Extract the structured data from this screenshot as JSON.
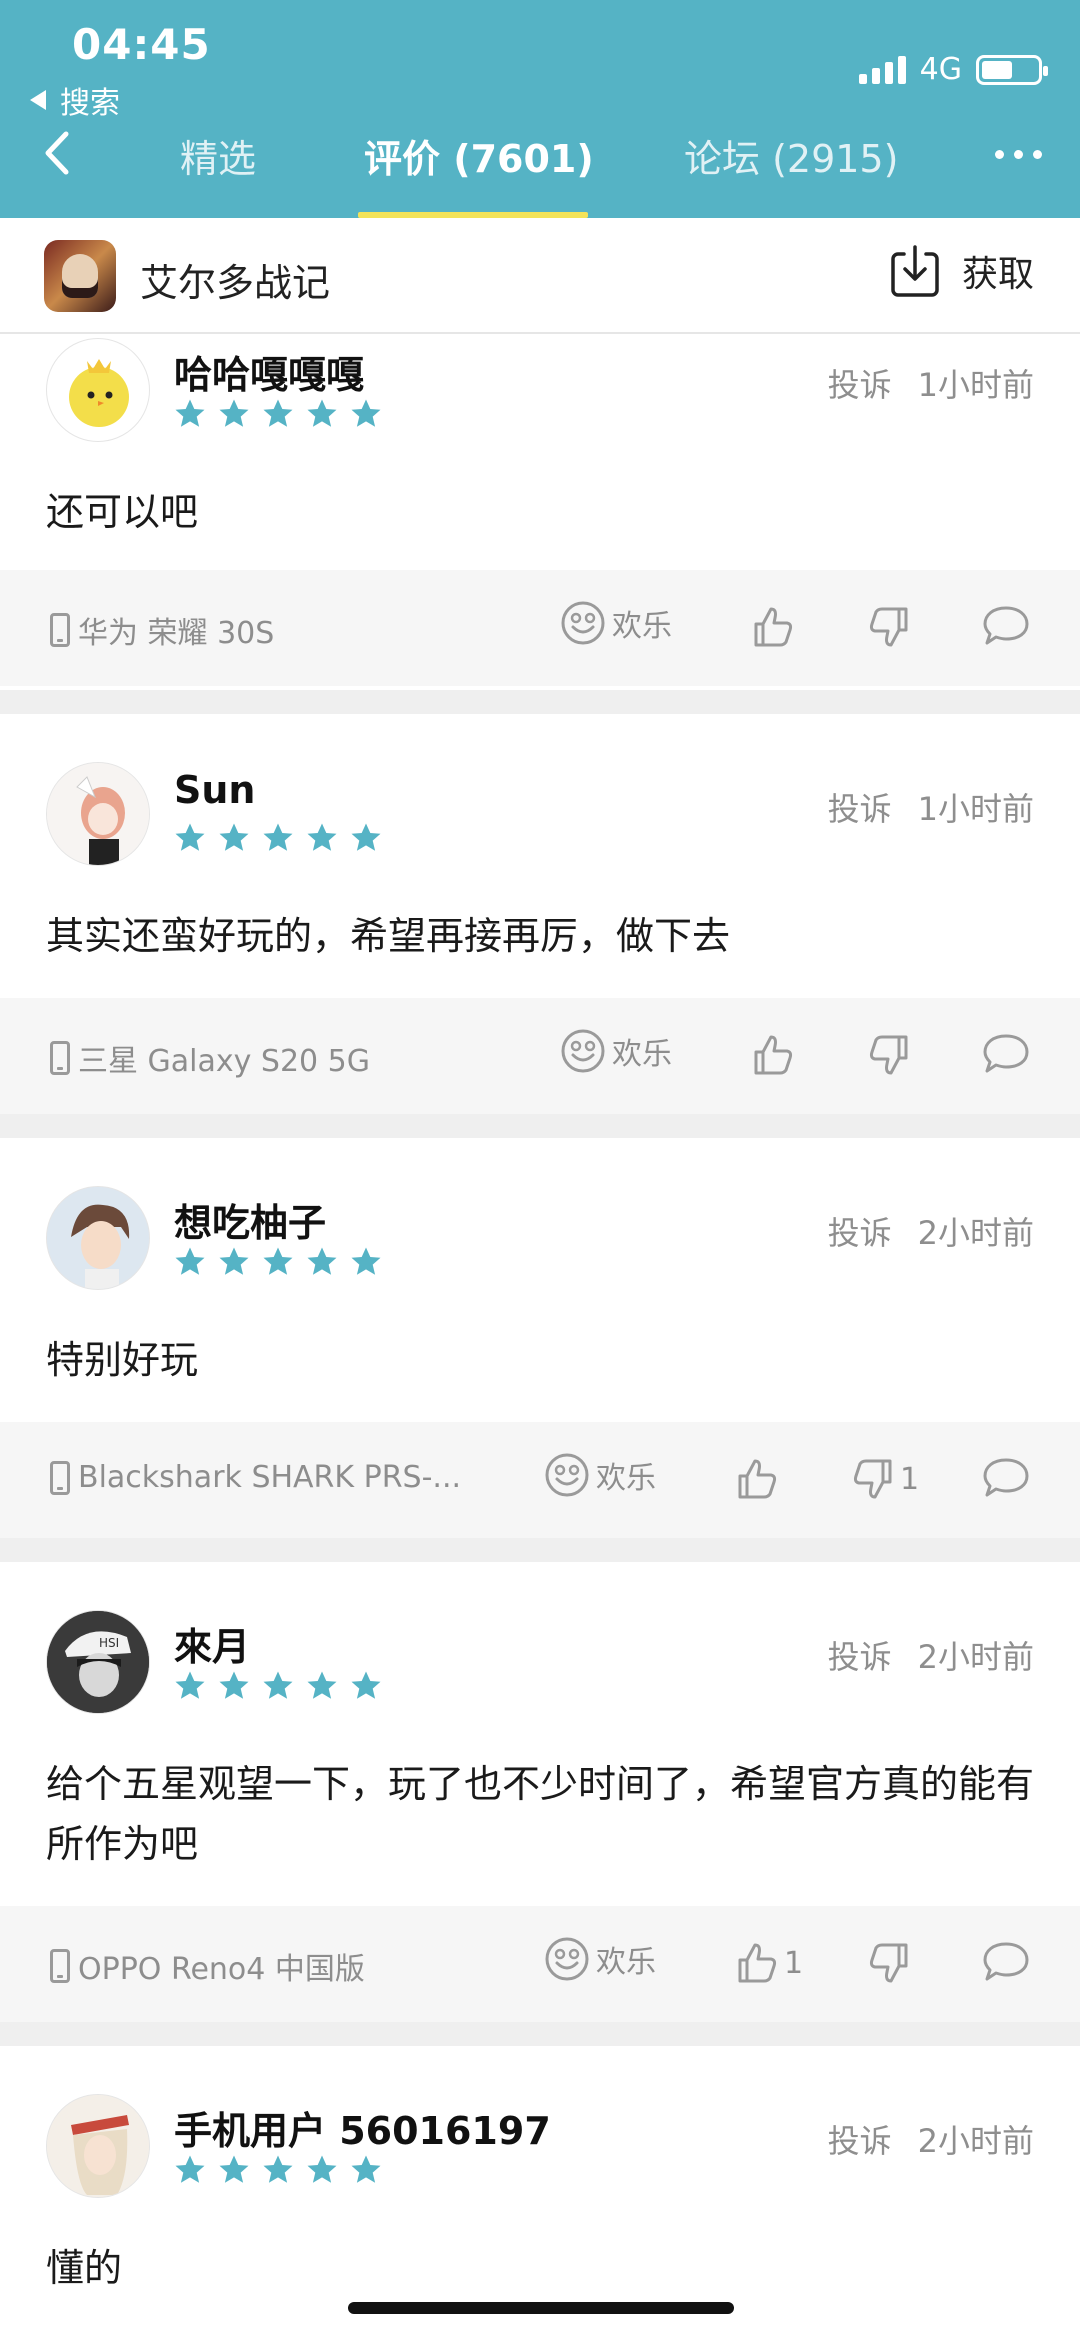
{
  "status": {
    "time": "04:45",
    "back_label": "搜索",
    "network": "4G"
  },
  "tabs": [
    {
      "label": "精选"
    },
    {
      "label": "评价 (7601)"
    },
    {
      "label": "论坛 (2915)"
    }
  ],
  "app": {
    "name": "艾尔多战记",
    "get_label": "获取"
  },
  "accent_color": "#55b3c5",
  "reviews": [
    {
      "user": "哈哈嘎嘎嘎",
      "rating": 5,
      "report": "投诉",
      "time": "1小时前",
      "text": "还可以吧",
      "device": "华为 荣耀 30S",
      "mood": "欢乐",
      "likes": "",
      "dislikes": ""
    },
    {
      "user": "Sun",
      "rating": 5,
      "report": "投诉",
      "time": "1小时前",
      "text": "其实还蛮好玩的，希望再接再厉，做下去",
      "device": "三星 Galaxy S20 5G",
      "mood": "欢乐",
      "likes": "",
      "dislikes": ""
    },
    {
      "user": "想吃柚子",
      "rating": 5,
      "report": "投诉",
      "time": "2小时前",
      "text": "特别好玩",
      "device": "Blackshark SHARK PRS-...",
      "mood": "欢乐",
      "likes": "",
      "dislikes": "1"
    },
    {
      "user": "來月",
      "rating": 5,
      "report": "投诉",
      "time": "2小时前",
      "text": "给个五星观望一下，玩了也不少时间了，希望官方真的能有所作为吧",
      "device": "OPPO Reno4 中国版",
      "mood": "欢乐",
      "likes": "1",
      "dislikes": ""
    },
    {
      "user": "手机用户 56016197",
      "rating": 5,
      "report": "投诉",
      "time": "2小时前",
      "text": "懂的",
      "device": "",
      "mood": "",
      "likes": "",
      "dislikes": ""
    }
  ]
}
